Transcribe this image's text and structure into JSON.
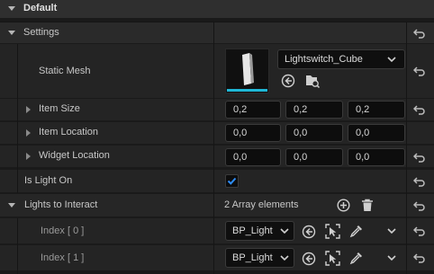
{
  "sections": {
    "default_label": "Default",
    "settings_label": "Settings"
  },
  "static_mesh": {
    "label": "Static Mesh",
    "asset_name": "Lightswitch_Cube"
  },
  "item_size": {
    "label": "Item Size",
    "x": "0,2",
    "y": "0,2",
    "z": "0,2"
  },
  "item_location": {
    "label": "Item Location",
    "x": "0,0",
    "y": "0,0",
    "z": "0,0"
  },
  "widget_location": {
    "label": "Widget Location",
    "x": "0,0",
    "y": "0,0",
    "z": "0,0"
  },
  "is_light_on": {
    "label": "Is Light On",
    "checked": true
  },
  "lights": {
    "label": "Lights to Interact",
    "count_text": "2 Array elements",
    "items": [
      {
        "index_label": "Index [ 0 ]",
        "value": "BP_Light"
      },
      {
        "index_label": "Index [ 1 ]",
        "value": "BP_Light"
      }
    ]
  },
  "colors": {
    "checkbox_accent": "#1e90ff",
    "mesh_underline": "#1fb7d6"
  },
  "icons": [
    "reset-arrow-icon",
    "chevron-down-icon",
    "use-selected-icon",
    "browse-asset-icon",
    "add-element-icon",
    "delete-icon",
    "eyedropper-icon",
    "select-actor-icon",
    "checkmark-icon"
  ]
}
